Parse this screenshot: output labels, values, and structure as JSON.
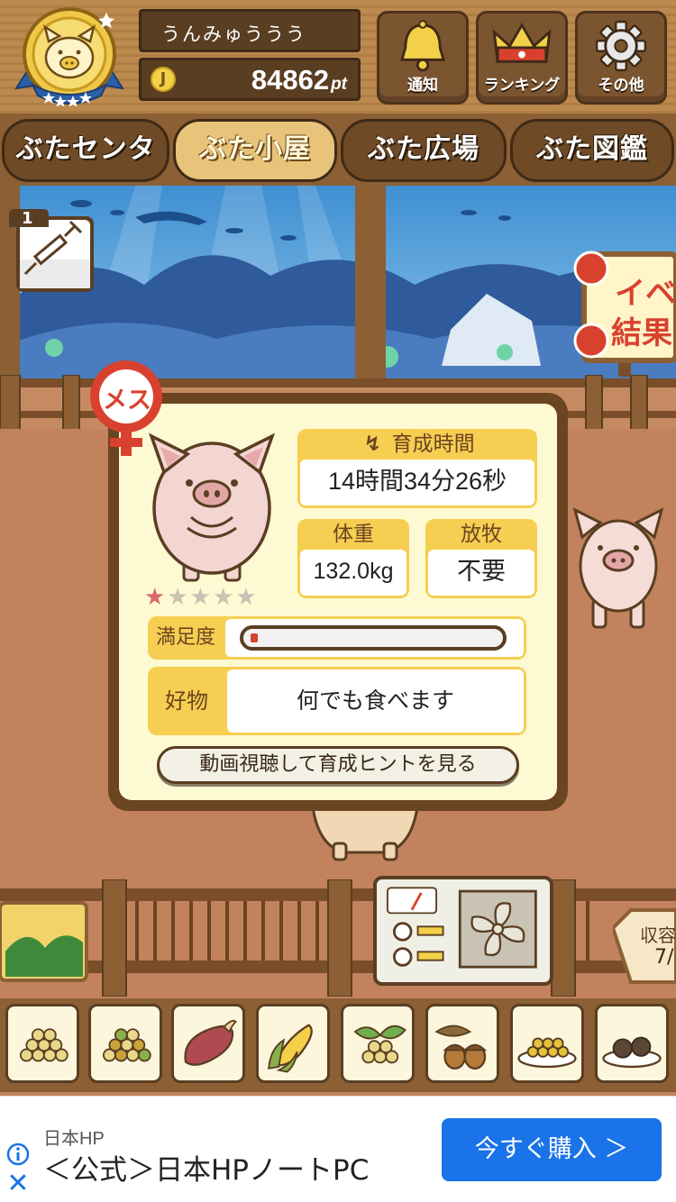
{
  "header": {
    "username": "うんみゅううう",
    "coin_symbol": "J",
    "points": "84862",
    "points_unit": "pt",
    "buttons": {
      "notice": "通知",
      "ranking": "ランキング",
      "other": "その他"
    }
  },
  "nav": {
    "tabs": [
      {
        "label": "ぶたセンター",
        "active": false
      },
      {
        "label": "ぶた小屋",
        "active": true
      },
      {
        "label": "ぶた広場",
        "active": false
      },
      {
        "label": "ぶた図鑑",
        "active": false
      }
    ]
  },
  "item_badge": {
    "count": "1",
    "icon": "syringe-icon"
  },
  "event_sign": {
    "line1": "イベ",
    "line2": "結果"
  },
  "pig_card": {
    "gender": "メス",
    "rarity_stars": 1,
    "rarity_max": 5,
    "growth_time_label": "育成時間",
    "growth_time_value": "14時間34分26秒",
    "weight_label": "体重",
    "weight_value": "132.0kg",
    "graze_label": "放牧",
    "graze_value": "不要",
    "satisfaction_label": "満足度",
    "satisfaction_level": 0.03,
    "favorite_label": "好物",
    "favorite_value": "何でも食べます",
    "hint_button": "動画視聴して育成ヒントを見る"
  },
  "capacity": {
    "label": "収容",
    "value": "7/"
  },
  "food_slots": [
    "grain-icon",
    "mixed-grain-icon",
    "sweet-potato-icon",
    "corn-icon",
    "vegetable-icon",
    "acorn-icon",
    "bean-plate-icon",
    "meatball-plate-icon"
  ],
  "ad": {
    "brand": "日本HP",
    "title": "＜公式＞日本HPノートPC",
    "cta": "今すぐ購入 ＞",
    "accent": "#1a73e8"
  }
}
